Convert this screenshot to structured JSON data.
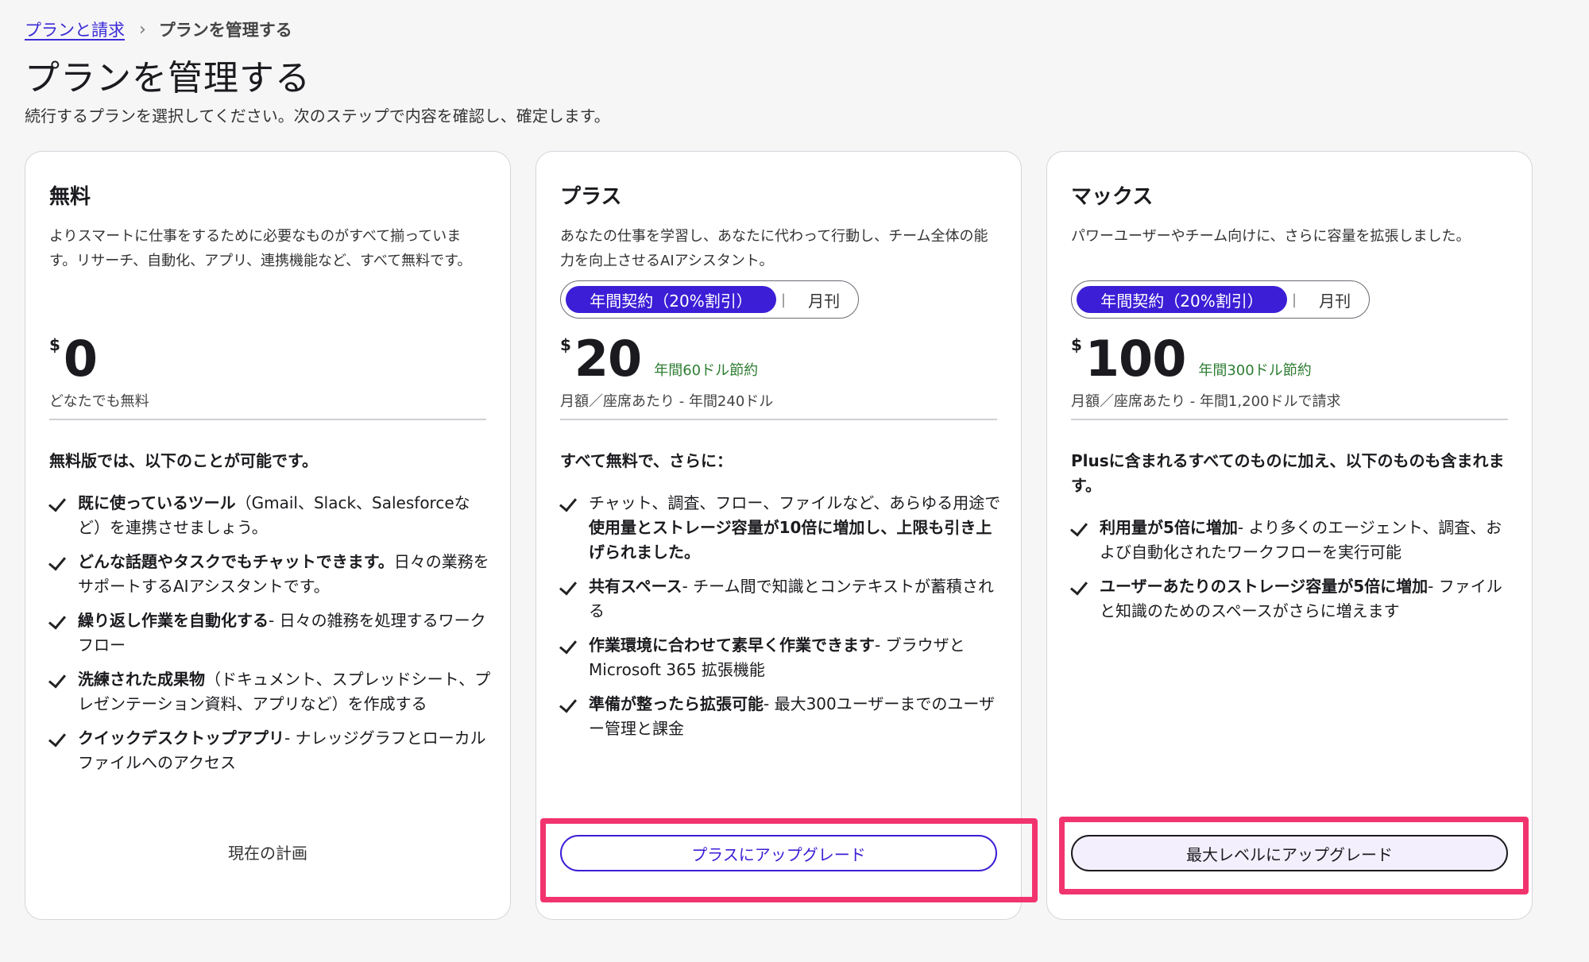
{
  "breadcrumb": {
    "parent": "プランと請求",
    "separator": "›",
    "current": "プランを管理する"
  },
  "page": {
    "title": "プランを管理する",
    "subtitle": "続行するプランを選択してください。次のステップで内容を確認し、確定します。"
  },
  "colors": {
    "accent": "#3b1ed6",
    "highlight": "#f2346e",
    "saving": "#2e7d32"
  },
  "plans": {
    "free": {
      "name": "無料",
      "description": "よりスマートに仕事をするために必要なものがすべて揃っています。リサーチ、自動化、アプリ、連携機能など、すべて無料です。",
      "currency": "$",
      "price": "0",
      "price_note": "どなたでも無料",
      "features_heading": "無料版では、以下のことが可能です。",
      "features": [
        {
          "bold": "既に使っているツール",
          "text": "（Gmail、Slack、Salesforceなど）を連携させましょう。"
        },
        {
          "bold": "どんな話題やタスクでもチャットできます。",
          "text": "日々の業務をサポートするAIアシスタントです。"
        },
        {
          "bold": "繰り返し作業を自動化する",
          "text": "- 日々の雑務を処理するワークフロー"
        },
        {
          "bold": "洗練された成果物",
          "text": "（ドキュメント、スプレッドシート、プレゼンテーション資料、アプリなど）を作成する"
        },
        {
          "bold": "クイックデスクトップアプリ",
          "text": "- ナレッジグラフとローカルファイルへのアクセス"
        }
      ],
      "current_label": "現在の計画"
    },
    "plus": {
      "name": "プラス",
      "description": "あなたの仕事を学習し、あなたに代わって行動し、チーム全体の能力を向上させるAIアシスタント。",
      "toggle": {
        "annual": "年間契約（20%割引）",
        "separator": "|",
        "monthly": "月刊"
      },
      "currency": "$",
      "price": "20",
      "saving": "年間60ドル節約",
      "price_note": "月額／座席あたり - 年間240ドル",
      "features_heading": "すべて無料で、さらに：",
      "features": [
        {
          "pre": "チャット、調査、フロー、ファイルなど、あらゆる用途で",
          "bold": "使用量とストレージ容量が10倍に増加し、上限も引き上げられました。",
          "text": ""
        },
        {
          "bold": "共有スペース",
          "text": "- チーム間で知識とコンテキストが蓄積される"
        },
        {
          "bold": "作業環境に合わせて素早く作業できます",
          "text": "- ブラウザとMicrosoft 365 拡張機能"
        },
        {
          "bold": "準備が整ったら拡張可能",
          "text": "- 最大300ユーザーまでのユーザー管理と課金"
        }
      ],
      "cta": "プラスにアップグレード"
    },
    "max": {
      "name": "マックス",
      "description": "パワーユーザーやチーム向けに、さらに容量を拡張しました。",
      "toggle": {
        "annual": "年間契約（20%割引）",
        "separator": "|",
        "monthly": "月刊"
      },
      "currency": "$",
      "price": "100",
      "saving": "年間300ドル節約",
      "price_note": "月額／座席あたり - 年間1,200ドルで請求",
      "features_heading": "Plusに含まれるすべてのものに加え、以下のものも含まれます。",
      "features": [
        {
          "bold": "利用量が5倍に増加",
          "text": "- より多くのエージェント、調査、および自動化されたワークフローを実行可能"
        },
        {
          "bold": "ユーザーあたりのストレージ容量が5倍に増加",
          "text": "- ファイルと知識のためのスペースがさらに増えます"
        }
      ],
      "cta": "最大レベルにアップグレード"
    }
  }
}
